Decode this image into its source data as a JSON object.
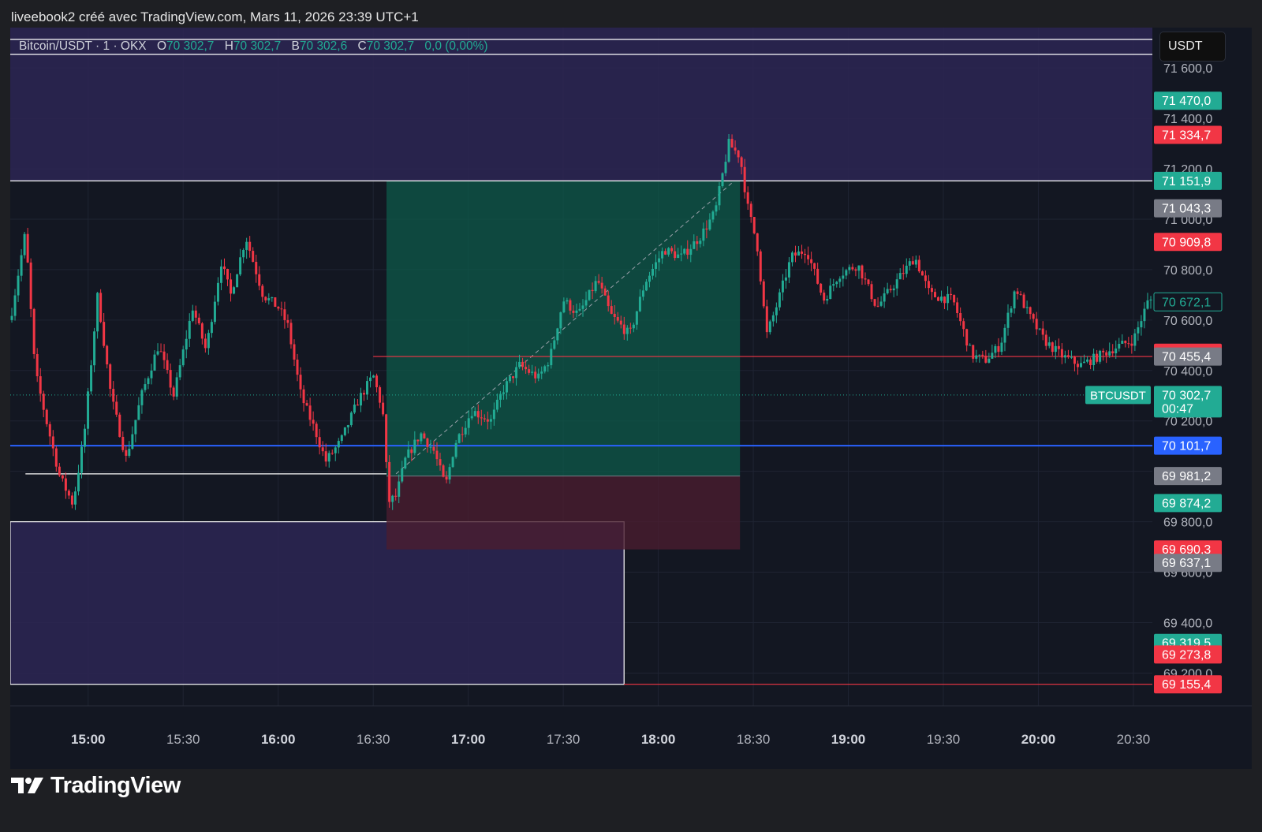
{
  "header": {
    "caption": "liveebook2 créé avec TradingView.com, Mars 11, 2026 23:39 UTC+1"
  },
  "symbol_bar": {
    "symbol": "Bitcoin/USDT · 1 · OKX",
    "open_label": "O",
    "open_value": "70 302,7",
    "high_label": "H",
    "high_value": "70 302,7",
    "low_label": "B",
    "low_value": "70 302,6",
    "close_label": "C",
    "close_value": "70 302,7",
    "change": "0,0 (0,00%)"
  },
  "price_scale": {
    "currency": "USDT"
  },
  "footer": {
    "brand": "TradingView",
    "logo_icon": "tradingview-logo-icon"
  },
  "colors": {
    "background": "#131722",
    "up": "#22ab94",
    "down": "#f23645",
    "zone_fill": "#2d2653",
    "profit_fill": "#0e5a4a",
    "loss_fill": "#4a1d2f",
    "blue_line": "#2962ff",
    "grey_label": "#787b86",
    "white_line": "#ffffff"
  },
  "chart_data": {
    "type": "candlestick",
    "symbol": "BTCUSDT",
    "x_ticks": [
      {
        "label": "15:00",
        "bold": true
      },
      {
        "label": "15:30",
        "bold": false
      },
      {
        "label": "16:00",
        "bold": true
      },
      {
        "label": "16:30",
        "bold": false
      },
      {
        "label": "17:00",
        "bold": true
      },
      {
        "label": "17:30",
        "bold": false
      },
      {
        "label": "18:00",
        "bold": true
      },
      {
        "label": "18:30",
        "bold": false
      },
      {
        "label": "19:00",
        "bold": true
      },
      {
        "label": "19:30",
        "bold": false
      },
      {
        "label": "20:00",
        "bold": true
      },
      {
        "label": "20:30",
        "bold": false
      }
    ],
    "y_ticks": [
      {
        "value": 71600,
        "label": "71 600,0"
      },
      {
        "value": 71400,
        "label": "71 400,0"
      },
      {
        "value": 71200,
        "label": "71 200,0"
      },
      {
        "value": 71000,
        "label": "71 000,0"
      },
      {
        "value": 70800,
        "label": "70 800,0"
      },
      {
        "value": 70600,
        "label": "70 600,0"
      },
      {
        "value": 70400,
        "label": "70 400,0"
      },
      {
        "value": 70200,
        "label": "70 200,0"
      },
      {
        "value": 70000,
        "label": "70 000,0"
      },
      {
        "value": 69800,
        "label": "69 800,0"
      },
      {
        "value": 69600,
        "label": "69 600,0"
      },
      {
        "value": 69400,
        "label": "69 400,0"
      },
      {
        "value": 69200,
        "label": "69 200,0"
      }
    ],
    "ylim": [
      69070,
      71760
    ],
    "price_labels": [
      {
        "value": 71470.0,
        "label": "71 470,0",
        "style": "green"
      },
      {
        "value": 71334.7,
        "label": "71 334,7",
        "style": "red"
      },
      {
        "value": 71151.9,
        "label": "71 151,9",
        "style": "green"
      },
      {
        "value": 71043.3,
        "label": "71 043,3",
        "style": "grey"
      },
      {
        "value": 70909.8,
        "label": "70 909,8",
        "style": "red"
      },
      {
        "value": 70672.1,
        "label": "70 672,1",
        "style": "outline"
      },
      {
        "value": 70470.4,
        "label": "70 470,4",
        "style": "red"
      },
      {
        "value": 70455.4,
        "label": "70 455,4",
        "style": "grey"
      },
      {
        "value": 70302.7,
        "label": "70 302,7",
        "sublabel": "00:47",
        "style": "green",
        "tag": "BTCUSDT"
      },
      {
        "value": 70101.7,
        "label": "70 101,7",
        "style": "blue"
      },
      {
        "value": 69981.2,
        "label": "69 981,2",
        "style": "grey"
      },
      {
        "value": 69874.2,
        "label": "69 874,2",
        "style": "green"
      },
      {
        "value": 69690.3,
        "label": "69 690,3",
        "style": "red"
      },
      {
        "value": 69637.1,
        "label": "69 637,1",
        "style": "grey"
      },
      {
        "value": 69319.5,
        "label": "69 319,5",
        "style": "green"
      },
      {
        "value": 69273.8,
        "label": "69 273,8",
        "style": "red"
      },
      {
        "value": 69155.4,
        "label": "69 155,4",
        "style": "red"
      }
    ],
    "horizontal_lines": [
      {
        "value": 70101.7,
        "from_time": 14.59,
        "to_time": 20.6,
        "color": "blue"
      },
      {
        "value": 71151.9,
        "from_time": 14.59,
        "to_time": 20.6,
        "color": "white"
      },
      {
        "value": 70455.4,
        "from_time": 16.5,
        "to_time": 20.6,
        "color": "red"
      },
      {
        "value": 69155.4,
        "from_time": 17.82,
        "to_time": 20.6,
        "color": "red"
      },
      {
        "value": 69990,
        "from_time": 14.67,
        "to_time": 16.57,
        "color": "white"
      }
    ],
    "zones": [
      {
        "top": 71760,
        "bottom": 71151.9,
        "from_time": 14.59,
        "to_time": 20.6
      },
      {
        "top": 69800,
        "bottom": 69155.4,
        "from_time": 14.59,
        "to_time": 17.82
      }
    ],
    "position": {
      "from_time": 16.57,
      "to_time": 18.43,
      "entry": 69981.2,
      "target": 71151.9,
      "stop": 69690.3
    },
    "key_points": [
      {
        "time": 14.59,
        "price": 70600
      },
      {
        "time": 14.67,
        "price": 70950
      },
      {
        "time": 14.72,
        "price": 70400
      },
      {
        "time": 14.78,
        "price": 70200
      },
      {
        "time": 14.85,
        "price": 69980
      },
      {
        "time": 14.92,
        "price": 69870
      },
      {
        "time": 14.98,
        "price": 70150
      },
      {
        "time": 15.05,
        "price": 70700
      },
      {
        "time": 15.12,
        "price": 70300
      },
      {
        "time": 15.2,
        "price": 70050
      },
      {
        "time": 15.28,
        "price": 70300
      },
      {
        "time": 15.37,
        "price": 70500
      },
      {
        "time": 15.45,
        "price": 70300
      },
      {
        "time": 15.55,
        "price": 70650
      },
      {
        "time": 15.62,
        "price": 70480
      },
      {
        "time": 15.7,
        "price": 70830
      },
      {
        "time": 15.75,
        "price": 70700
      },
      {
        "time": 15.83,
        "price": 70930
      },
      {
        "time": 15.92,
        "price": 70700
      },
      {
        "time": 16.0,
        "price": 70650
      },
      {
        "time": 16.05,
        "price": 70580
      },
      {
        "time": 16.12,
        "price": 70300
      },
      {
        "time": 16.2,
        "price": 70150
      },
      {
        "time": 16.25,
        "price": 70040
      },
      {
        "time": 16.33,
        "price": 70120
      },
      {
        "time": 16.42,
        "price": 70280
      },
      {
        "time": 16.5,
        "price": 70380
      },
      {
        "time": 16.55,
        "price": 70240
      },
      {
        "time": 16.58,
        "price": 69880
      },
      {
        "time": 16.62,
        "price": 69900
      },
      {
        "time": 16.67,
        "price": 70050
      },
      {
        "time": 16.75,
        "price": 70150
      },
      {
        "time": 16.82,
        "price": 70080
      },
      {
        "time": 16.88,
        "price": 69940
      },
      {
        "time": 16.93,
        "price": 70110
      },
      {
        "time": 17.02,
        "price": 70240
      },
      {
        "time": 17.12,
        "price": 70200
      },
      {
        "time": 17.18,
        "price": 70320
      },
      {
        "time": 17.27,
        "price": 70420
      },
      {
        "time": 17.37,
        "price": 70370
      },
      {
        "time": 17.43,
        "price": 70450
      },
      {
        "time": 17.5,
        "price": 70680
      },
      {
        "time": 17.58,
        "price": 70620
      },
      {
        "time": 17.68,
        "price": 70760
      },
      {
        "time": 17.75,
        "price": 70620
      },
      {
        "time": 17.85,
        "price": 70540
      },
      {
        "time": 17.93,
        "price": 70750
      },
      {
        "time": 18.03,
        "price": 70880
      },
      {
        "time": 18.12,
        "price": 70850
      },
      {
        "time": 18.22,
        "price": 70930
      },
      {
        "time": 18.3,
        "price": 71030
      },
      {
        "time": 18.37,
        "price": 71300
      },
      {
        "time": 18.43,
        "price": 71250
      },
      {
        "time": 18.47,
        "price": 71050
      },
      {
        "time": 18.52,
        "price": 70900
      },
      {
        "time": 18.57,
        "price": 70540
      },
      {
        "time": 18.62,
        "price": 70650
      },
      {
        "time": 18.7,
        "price": 70850
      },
      {
        "time": 18.78,
        "price": 70880
      },
      {
        "time": 18.87,
        "price": 70680
      },
      {
        "time": 18.95,
        "price": 70780
      },
      {
        "time": 19.05,
        "price": 70820
      },
      {
        "time": 19.15,
        "price": 70650
      },
      {
        "time": 19.25,
        "price": 70750
      },
      {
        "time": 19.35,
        "price": 70850
      },
      {
        "time": 19.43,
        "price": 70700
      },
      {
        "time": 19.55,
        "price": 70680
      },
      {
        "time": 19.65,
        "price": 70460
      },
      {
        "time": 19.72,
        "price": 70440
      },
      {
        "time": 19.8,
        "price": 70500
      },
      {
        "time": 19.88,
        "price": 70730
      },
      {
        "time": 19.95,
        "price": 70620
      },
      {
        "time": 20.03,
        "price": 70520
      },
      {
        "time": 20.12,
        "price": 70460
      },
      {
        "time": 20.22,
        "price": 70420
      },
      {
        "time": 20.3,
        "price": 70450
      },
      {
        "time": 20.4,
        "price": 70490
      },
      {
        "time": 20.5,
        "price": 70520
      },
      {
        "time": 20.58,
        "price": 70680
      }
    ]
  }
}
